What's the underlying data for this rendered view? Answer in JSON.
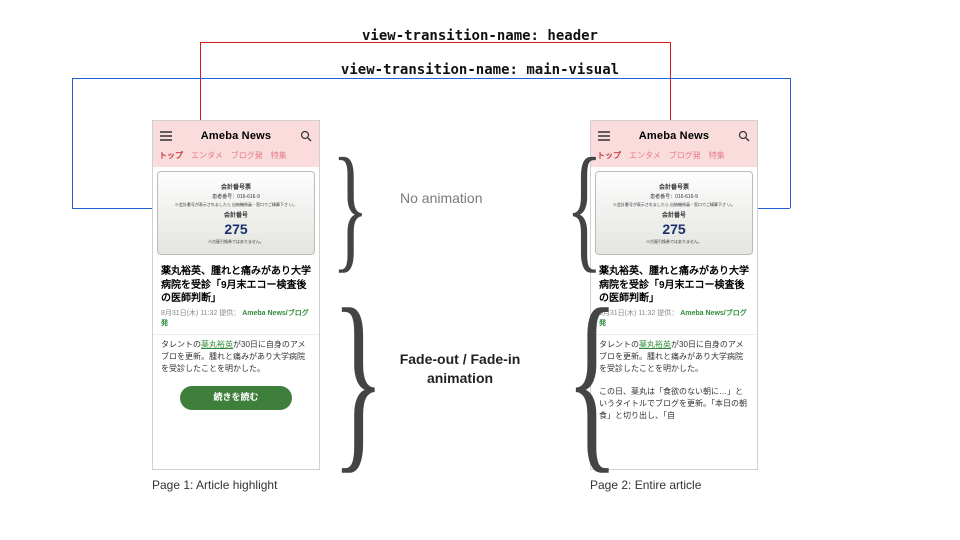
{
  "annotations": {
    "header": "view-transition-name: header",
    "visual": "view-transition-name: main-visual"
  },
  "labels": {
    "no_animation": "No animation",
    "fade": "Fade-out / Fade-in animation",
    "page1_caption": "Page 1: Article highlight",
    "page2_caption": "Page 2: Entire article"
  },
  "phone": {
    "brand": "Ameba News",
    "tabs": [
      "トップ",
      "エンタメ",
      "ブログ発",
      "特集"
    ],
    "ticket": {
      "header": "会計番号票",
      "line1": "患者番号：016-616-9",
      "line2": "※会計番号が表示されましたら 出納機係員・窓口でご精算下さ い。",
      "num_label": "会計番号",
      "num": "275",
      "foot": "※古屋引換券ではありません。"
    },
    "title": "薬丸裕英、腫れと痛みがあり大学病院を受診「9月末エコー検査後の医師判断」",
    "meta_time": "8月31日(木) 11:32",
    "meta_by": "提供：",
    "meta_source": "Ameba News/ブログ発",
    "body1_pre": "タレントの",
    "body1_link": "薬丸裕英",
    "body1_post": "が30日に自身のアメブロを更新。腫れと痛みがあり大学病院を受診したことを明かした。",
    "more": "続きを読む",
    "body2": "この日、薬丸は「食欲のない朝に…」というタイトルでブログを更新。「本日の朝食」と切り出し、「自"
  }
}
